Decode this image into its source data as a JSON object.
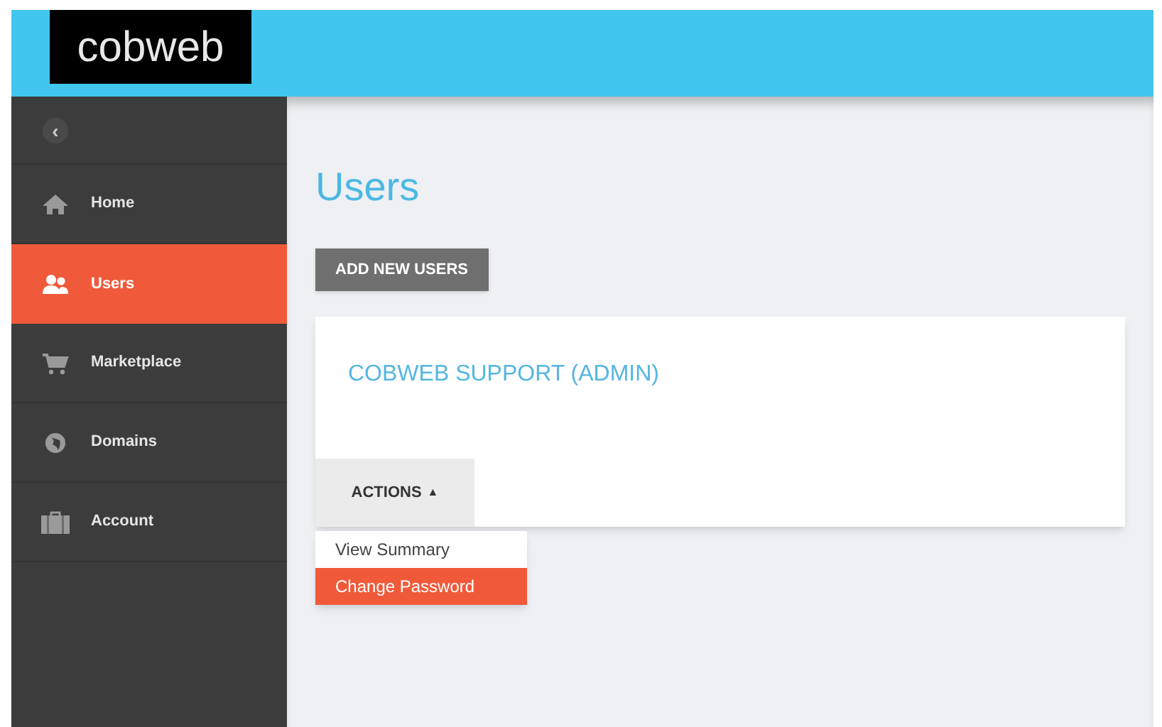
{
  "header": {
    "logo": "cobweb"
  },
  "sidebar": {
    "collapse_glyph": "‹",
    "items": [
      {
        "label": "Home",
        "kind": "home",
        "selected": false
      },
      {
        "label": "Users",
        "kind": "users",
        "selected": true
      },
      {
        "label": "Marketplace",
        "kind": "cart",
        "selected": false
      },
      {
        "label": "Domains",
        "kind": "globe",
        "selected": false
      },
      {
        "label": "Account",
        "kind": "briefcase",
        "selected": false
      }
    ]
  },
  "main": {
    "title": "Users",
    "add_button": "ADD NEW USERS",
    "user_card": {
      "name": "COBWEB SUPPORT (ADMIN)",
      "actions_button": "ACTIONS",
      "actions_glyph": "▲",
      "expanded": true,
      "menu": [
        {
          "label": "View Summary",
          "selected": false
        },
        {
          "label": "Change Password",
          "selected": true
        }
      ]
    }
  }
}
